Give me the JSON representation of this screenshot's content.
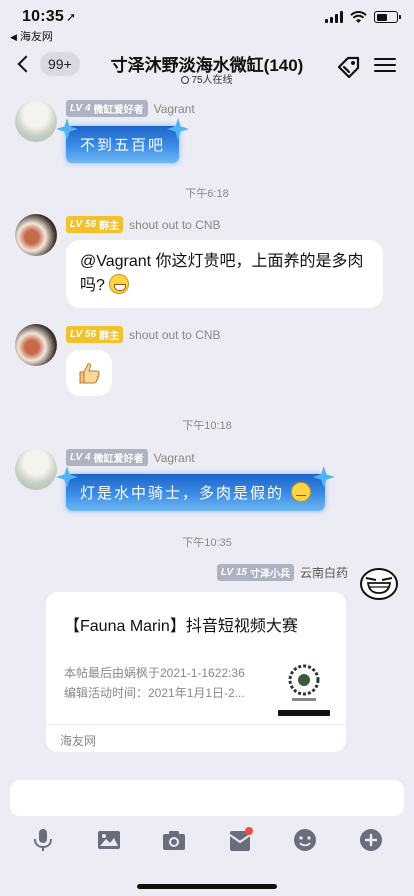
{
  "status_bar": {
    "time": "10:35",
    "back_app": "海友网"
  },
  "nav": {
    "badge": "99+",
    "title": "寸泽沐野淡海水微缸(140)",
    "online": "75人在线"
  },
  "messages": [
    {
      "level": "LV 4",
      "title": "微缸爱好者",
      "name": "Vagrant",
      "text": "不到五百吧"
    },
    {
      "time": "下午6:18"
    },
    {
      "level": "LV 56",
      "title": "群主",
      "name": "shout out to CNB",
      "text": "@Vagrant 你这灯贵吧，上面养的是多肉吗?"
    },
    {
      "level": "LV 56",
      "title": "群主",
      "name": "shout out to CNB",
      "sticker": "thumbs-up"
    },
    {
      "time": "下午10:18"
    },
    {
      "level": "LV 4",
      "title": "微缸爱好者",
      "name": "Vagrant",
      "text": "灯是水中骑士，多肉是假的"
    },
    {
      "time": "下午10:35"
    },
    {
      "level": "LV 15",
      "title": "寸泽小兵",
      "name": "云南白药"
    }
  ],
  "card": {
    "title": "【Fauna Marin】抖音短视频大赛",
    "line1": "本帖最后由娲枫于2021-1-1622:36",
    "line2": "编辑活动时间：2021年1月1日-2...",
    "footer": "海友网"
  },
  "colors": {
    "background": "#ececf5",
    "bubble": "#ffffff",
    "level_gold": "#f3c12c",
    "level_gray": "#aeb2c2",
    "ice_bubble": "#3c8ee6",
    "notify_dot": "#f04c3c"
  },
  "toolbar_icons": [
    "microphone-icon",
    "image-icon",
    "camera-icon",
    "red-packet-icon",
    "emoji-icon",
    "plus-icon"
  ]
}
